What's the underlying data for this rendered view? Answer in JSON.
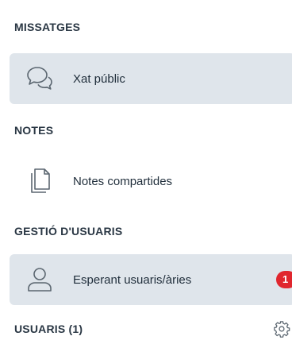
{
  "sections": {
    "messages": {
      "title": "MISSATGES",
      "items": [
        {
          "label": "Xat públic",
          "icon": "chat-bubbles-icon",
          "active": true
        }
      ]
    },
    "notes": {
      "title": "NOTES",
      "items": [
        {
          "label": "Notes compartides",
          "icon": "documents-icon",
          "active": false
        }
      ]
    },
    "user_management": {
      "title": "GESTIÓ D'USUARIS",
      "items": [
        {
          "label": "Esperant usuaris/àries",
          "icon": "user-icon",
          "active": true,
          "badge": "1"
        }
      ]
    },
    "users": {
      "title": "USUARIS (1)",
      "action_icon": "gear-icon"
    }
  },
  "colors": {
    "active_background": "#dfe5eb",
    "badge": "#e0262e",
    "icon_stroke": "#5b6670"
  }
}
